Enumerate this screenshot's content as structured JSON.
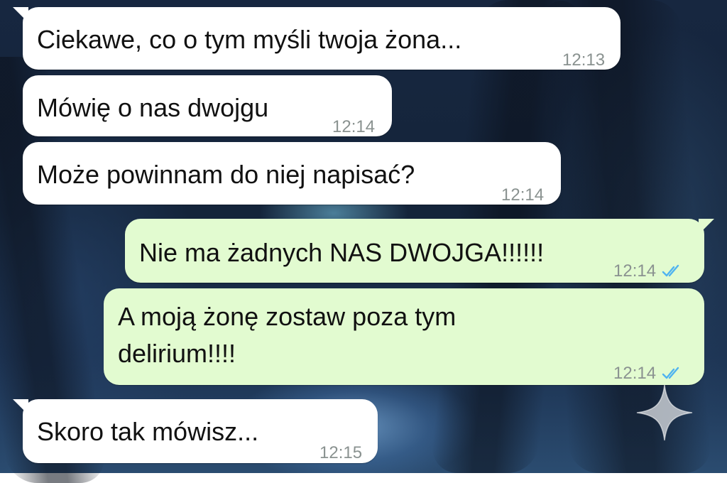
{
  "conversation": {
    "messages": [
      {
        "direction": "incoming",
        "text": "Ciekawe, co o tym myśli twoja żona...",
        "time": "12:13"
      },
      {
        "direction": "incoming",
        "text": "Mówię o nas dwojgu",
        "time": "12:14"
      },
      {
        "direction": "incoming",
        "text": "Może powinnam do niej napisać?",
        "time": "12:14"
      },
      {
        "direction": "outgoing",
        "text": "Nie ma żadnych NAS DWOJGA!!!!!!",
        "time": "12:14",
        "status_icon": "double-check-read-icon"
      },
      {
        "direction": "outgoing",
        "text": "A moją żonę zostaw poza tym delirium!!!!",
        "time": "12:14",
        "status_icon": "double-check-read-icon"
      },
      {
        "direction": "incoming",
        "text": "Skoro tak mówisz...",
        "time": "12:15"
      }
    ]
  },
  "colors": {
    "incoming_bubble": "#ffffff",
    "outgoing_bubble": "#e2fbd0",
    "read_tick": "#4fb3f0",
    "timestamp": "#8a9290"
  },
  "overlay": {
    "icon": "sparkle-icon"
  }
}
